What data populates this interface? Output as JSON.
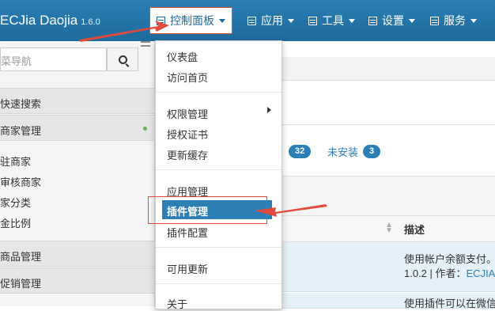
{
  "brand": {
    "name": "ECJia Daojia",
    "version": "1.6.0"
  },
  "nav": [
    {
      "label": "控制面板",
      "icon": "dashboard-icon",
      "active": true
    },
    {
      "label": "应用",
      "icon": "apps-icon"
    },
    {
      "label": "工具",
      "icon": "tools-icon"
    },
    {
      "label": "设置",
      "icon": "settings-icon"
    },
    {
      "label": "服务",
      "icon": "service-icon"
    }
  ],
  "sidebar": {
    "search_placeholder": "菜导航",
    "sections": [
      "快速搜索",
      "商家管理",
      "商品管理",
      "促销管理"
    ],
    "sub_items": [
      "驻商家",
      "审核商家",
      "家分类",
      "金比例"
    ]
  },
  "dropdown": {
    "items": [
      "仪表盘",
      "访问首页",
      "权限管理",
      "授权证书",
      "更新缓存",
      "应用管理",
      "插件管理",
      "插件配置",
      "可用更新",
      "关于"
    ],
    "active": "插件管理"
  },
  "main": {
    "installed_count": "32",
    "uninstalled_label": "未安装",
    "uninstalled_count": "3",
    "column_desc": "描述",
    "rows": [
      {
        "desc": "使用帐户余额支付。",
        "meta_prefix": "1.0.2 | 作者：",
        "author": "ECJIA"
      },
      {
        "desc": "使用插件可以在微信"
      }
    ]
  },
  "colors": {
    "primary": "#2b7fb4",
    "highlight": "#e24a3b"
  }
}
